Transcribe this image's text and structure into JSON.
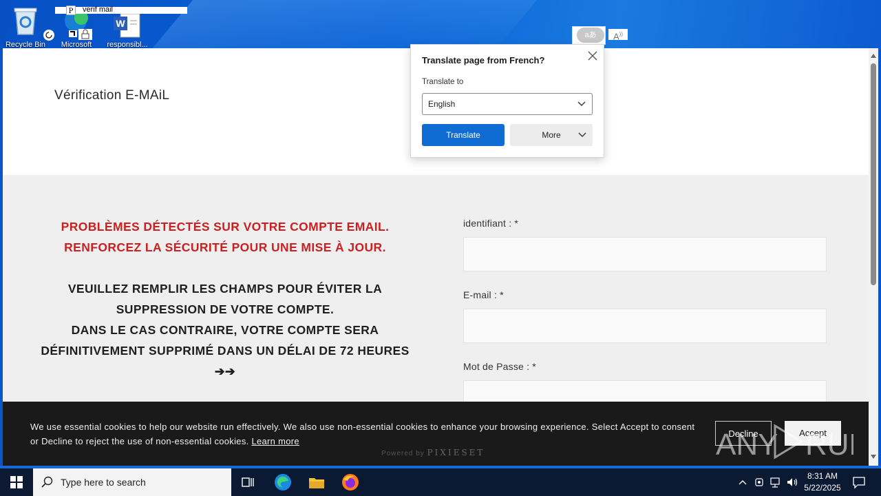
{
  "desktop": {
    "icons": [
      {
        "label": "Recycle Bin"
      },
      {
        "label": "Microsoft"
      },
      {
        "label": "responsibl..."
      }
    ],
    "window_title_fragment": "verif mail"
  },
  "page": {
    "site_title": "Vérification E-MAiL",
    "warning_red": [
      "PROBLÈMES DÉTECTÉS SUR VOTRE COMPTE EMAIL.",
      "RENFORCEZ LA SÉCURITÉ POUR UNE MISE À JOUR."
    ],
    "warning_black": [
      "VEUILLEZ REMPLIR LES CHAMPS POUR ÉVITER LA",
      "SUPPRESSION DE VOTRE COMPTE.",
      "DANS LE CAS CONTRAIRE, VOTRE COMPTE SERA",
      "DÉFINITIVEMENT SUPPRIMÉ DANS UN DÉLAI DE 72 HEURES",
      "➔➔"
    ],
    "form": {
      "identifiant_label": "identifiant : *",
      "email_label": "E-mail : *",
      "password_label": "Mot de Passe : *"
    },
    "powered_by": "Powered by",
    "powered_brand": "PIXIESET"
  },
  "cookie_bar": {
    "text": "We use essential cookies to help our website run effectively. We also use non-essential cookies to enhance your browsing experience. Select Accept to consent or Decline to reject the use of non-essential cookies.",
    "learn_more": "Learn more",
    "decline_label": "Decline",
    "accept_label": "Accept"
  },
  "translate_popup": {
    "title": "Translate page from French?",
    "translate_to_label": "Translate to",
    "selected_language": "English",
    "translate_button": "Translate",
    "more_button": "More",
    "icon_text": "aあ"
  },
  "taskbar": {
    "search_placeholder": "Type here to search",
    "time": "8:31 AM",
    "date": "5/22/2025"
  },
  "colors": {
    "accent_blue": "#0f6cd3",
    "warning_red": "#cc1f1f",
    "taskbar_bg": "#0c1933"
  }
}
